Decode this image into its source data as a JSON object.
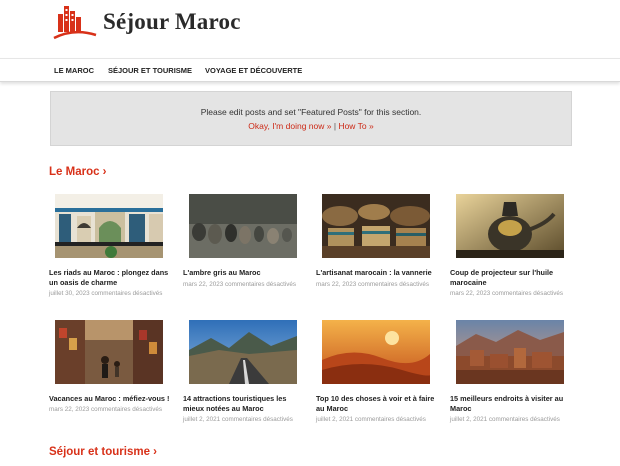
{
  "site": {
    "name": "Séjour Maroc",
    "brand_color": "#d83119"
  },
  "nav": {
    "items": [
      {
        "label": "LE MAROC"
      },
      {
        "label": "SÉJOUR ET TOURISME"
      },
      {
        "label": "VOYAGE ET DÉCOUVERTE"
      }
    ]
  },
  "featured": {
    "message": "Please edit posts and set \"Featured Posts\" for this section.",
    "link_ok": "Okay, I'm doing now »",
    "separator": "|",
    "link_howto": "How To »"
  },
  "sections": [
    {
      "title": "Le Maroc ›",
      "posts": [
        {
          "title": "Les riads au Maroc : plongez dans un oasis de charme",
          "date": "juillet 30, 2023",
          "comments": "commentaires désactivés",
          "image": "riad-courtyard"
        },
        {
          "title": "L'ambre gris au Maroc",
          "date": "mars 22, 2023",
          "comments": "commentaires désactivés",
          "image": "ambergris-stones"
        },
        {
          "title": "L'artisanat marocain : la vannerie",
          "date": "mars 22, 2023",
          "comments": "commentaires désactivés",
          "image": "baskets"
        },
        {
          "title": "Coup de projecteur sur l'huile marocaine",
          "date": "mars 22, 2023",
          "comments": "commentaires désactivés",
          "image": "oil-pot"
        },
        {
          "title": "Vacances au Maroc : méfiez-vous !",
          "date": "mars 22, 2023",
          "comments": "commentaires désactivés",
          "image": "souk-market"
        },
        {
          "title": "14 attractions touristiques les mieux notées au Maroc",
          "date": "juillet 2, 2021",
          "comments": "commentaires désactivés",
          "image": "mountain-road"
        },
        {
          "title": "Top 10 des choses à voir et à faire au Maroc",
          "date": "juillet 2, 2021",
          "comments": "commentaires désactivés",
          "image": "desert-dunes"
        },
        {
          "title": "15 meilleurs endroits à visiter au Maroc",
          "date": "juillet 2, 2021",
          "comments": "commentaires désactivés",
          "image": "kasbah-mountains"
        }
      ]
    },
    {
      "title": "Séjour et tourisme ›",
      "posts": []
    }
  ]
}
